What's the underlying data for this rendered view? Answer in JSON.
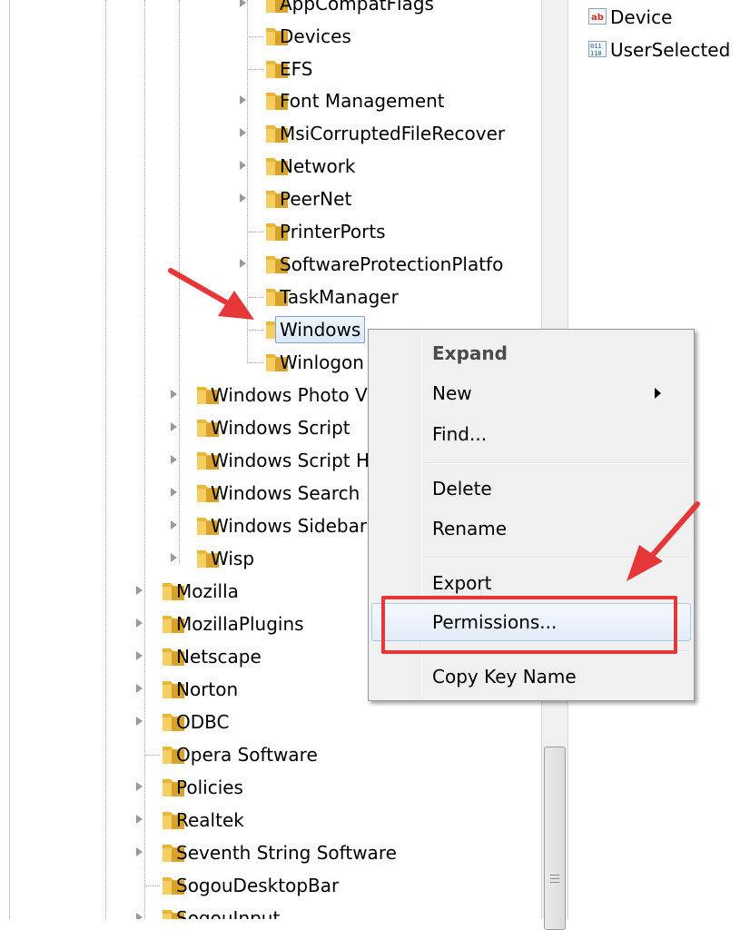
{
  "tree": {
    "nodes": [
      {
        "label": "AppCompatFlags",
        "expandable": true,
        "level": 2,
        "selected": false
      },
      {
        "label": "Devices",
        "expandable": false,
        "level": 2,
        "selected": false
      },
      {
        "label": "EFS",
        "expandable": false,
        "level": 2,
        "selected": false
      },
      {
        "label": "Font Management",
        "expandable": true,
        "level": 2,
        "selected": false
      },
      {
        "label": "MsiCorruptedFileRecover",
        "expandable": true,
        "level": 2,
        "selected": false
      },
      {
        "label": "Network",
        "expandable": true,
        "level": 2,
        "selected": false
      },
      {
        "label": "PeerNet",
        "expandable": true,
        "level": 2,
        "selected": false
      },
      {
        "label": "PrinterPorts",
        "expandable": false,
        "level": 2,
        "selected": false
      },
      {
        "label": "SoftwareProtectionPlatfo",
        "expandable": true,
        "level": 2,
        "selected": false
      },
      {
        "label": "TaskManager",
        "expandable": false,
        "level": 2,
        "selected": false
      },
      {
        "label": "Windows",
        "expandable": false,
        "level": 2,
        "selected": true
      },
      {
        "label": "Winlogon",
        "expandable": false,
        "level": 2,
        "selected": false
      },
      {
        "label": "Windows Photo Viewer",
        "expandable": true,
        "level": 1,
        "selected": false
      },
      {
        "label": "Windows Script",
        "expandable": true,
        "level": 1,
        "selected": false
      },
      {
        "label": "Windows Script Host",
        "expandable": true,
        "level": 1,
        "selected": false
      },
      {
        "label": "Windows Search",
        "expandable": true,
        "level": 1,
        "selected": false
      },
      {
        "label": "Windows Sidebar",
        "expandable": true,
        "level": 1,
        "selected": false
      },
      {
        "label": "Wisp",
        "expandable": true,
        "level": 1,
        "selected": false
      },
      {
        "label": "Mozilla",
        "expandable": true,
        "level": 0,
        "selected": false
      },
      {
        "label": "MozillaPlugins",
        "expandable": true,
        "level": 0,
        "selected": false
      },
      {
        "label": "Netscape",
        "expandable": true,
        "level": 0,
        "selected": false
      },
      {
        "label": "Norton",
        "expandable": true,
        "level": 0,
        "selected": false
      },
      {
        "label": "ODBC",
        "expandable": true,
        "level": 0,
        "selected": false
      },
      {
        "label": "Opera Software",
        "expandable": false,
        "level": 0,
        "selected": false
      },
      {
        "label": "Policies",
        "expandable": true,
        "level": 0,
        "selected": false
      },
      {
        "label": "Realtek",
        "expandable": true,
        "level": 0,
        "selected": false
      },
      {
        "label": "Seventh String Software",
        "expandable": true,
        "level": 0,
        "selected": false
      },
      {
        "label": "SogouDesktopBar",
        "expandable": false,
        "level": 0,
        "selected": false
      },
      {
        "label": "SogouInput",
        "expandable": true,
        "level": 0,
        "selected": false
      }
    ]
  },
  "values_pane": {
    "rows": [
      {
        "label": "Device",
        "icon": "string-value-icon"
      },
      {
        "label": "UserSelected",
        "icon": "binary-value-icon"
      }
    ]
  },
  "context_menu": {
    "items": [
      {
        "label": "Expand",
        "bold": true,
        "submenu": false
      },
      {
        "label": "New",
        "bold": false,
        "submenu": true
      },
      {
        "label": "Find...",
        "bold": false,
        "submenu": false
      },
      {
        "label": "Delete",
        "bold": false,
        "submenu": false
      },
      {
        "label": "Rename",
        "bold": false,
        "submenu": false
      },
      {
        "label": "Export",
        "bold": false,
        "submenu": false
      },
      {
        "label": "Permissions...",
        "bold": false,
        "submenu": false
      },
      {
        "label": "Copy Key Name",
        "bold": false,
        "submenu": false
      }
    ],
    "hovered": "Permissions..."
  },
  "annotations": {
    "arrow_color": "#e63638",
    "highlight_color": "#e63638"
  },
  "colors": {
    "folder": "#e8b63a",
    "selection_border": "#7da2ce",
    "menu_background": "#f0f0f0"
  }
}
